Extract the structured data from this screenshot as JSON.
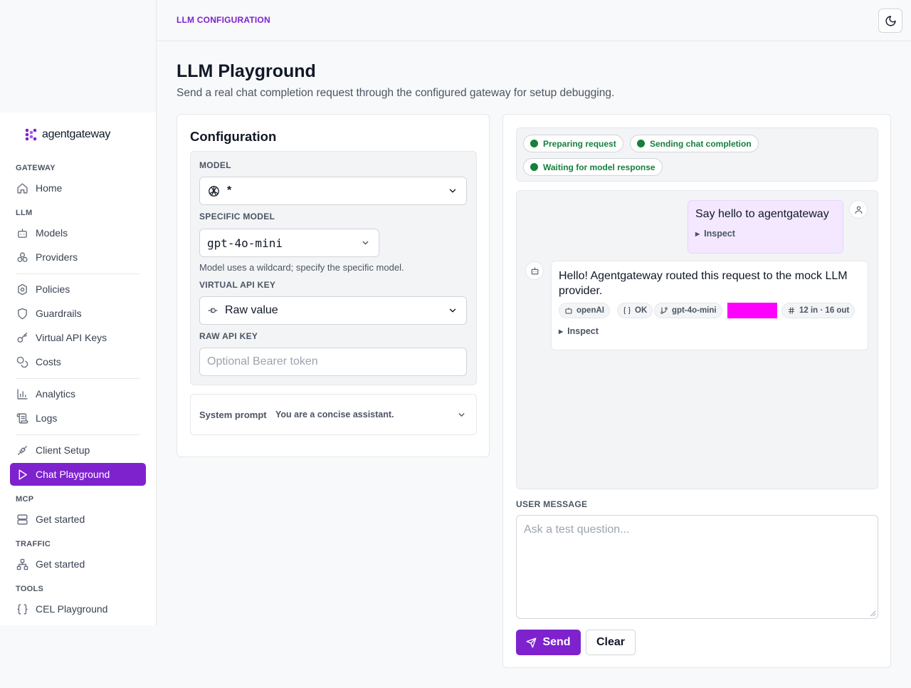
{
  "brand": {
    "name": "agentgateway",
    "accent": "#7e22ce"
  },
  "header": {
    "breadcrumb": "LLM CONFIGURATION",
    "theme_icon": "moon-icon"
  },
  "page": {
    "title": "LLM Playground",
    "subtitle": "Send a real chat completion request through the configured gateway for setup debugging."
  },
  "sidebar": {
    "sections": {
      "gateway": "GATEWAY",
      "llm": "LLM",
      "mcp": "MCP",
      "traffic": "TRAFFIC",
      "tools": "TOOLS"
    },
    "items": {
      "home": "Home",
      "models": "Models",
      "providers": "Providers",
      "policies": "Policies",
      "guardrails": "Guardrails",
      "virtual_api_keys": "Virtual API Keys",
      "costs": "Costs",
      "analytics": "Analytics",
      "logs": "Logs",
      "client_setup": "Client Setup",
      "chat_playground": "Chat Playground",
      "mcp_get_started": "Get started",
      "traffic_get_started": "Get started",
      "cel_playground": "CEL Playground"
    },
    "active_item": "Chat Playground"
  },
  "config": {
    "title": "Configuration",
    "model_label": "MODEL",
    "model_value": "*",
    "specific_model_label": "SPECIFIC MODEL",
    "specific_model_value": "gpt-4o-mini",
    "specific_model_hint": "Model uses a wildcard; specify the specific model.",
    "virtual_key_label": "VIRTUAL API KEY",
    "virtual_key_value": "Raw value",
    "raw_key_label": "RAW API KEY",
    "raw_key_placeholder": "Optional Bearer token",
    "system_prompt_label": "System prompt",
    "system_prompt_value": "You are a concise assistant."
  },
  "chat": {
    "statuses": [
      "Preparing request",
      "Sending chat completion",
      "Waiting for model response"
    ],
    "user_message": "Say hello to agentgateway",
    "user_inspect": "Inspect",
    "assistant_message": "Hello! Agentgateway routed this request to the mock LLM provider.",
    "assistant_meta": {
      "provider": "openAI",
      "status": "OK",
      "model": "gpt-4o-mini",
      "tokens": "12 in · 16 out"
    },
    "assistant_inspect": "Inspect",
    "input_label": "USER MESSAGE",
    "input_placeholder": "Ask a test question...",
    "send_label": "Send",
    "clear_label": "Clear"
  }
}
